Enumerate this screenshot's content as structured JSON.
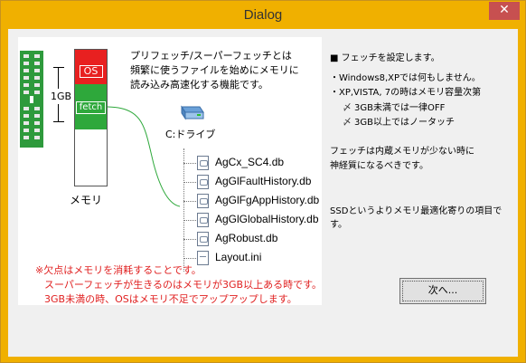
{
  "window": {
    "title": "Dialog",
    "close_glyph": "✕"
  },
  "diagram": {
    "memory_label": "メモリ",
    "os_label": "OS",
    "fetch_label": "fetch",
    "gb_label": "1GB",
    "intro_lines": [
      "プリフェッチ/スーパーフェッチとは",
      "頻繁に使うファイルを始めにメモリに",
      "読み込み高速化する機能です。"
    ],
    "drive_label": "C:ドライブ",
    "files": [
      "AgCx_SC4.db",
      "AgGlFaultHistory.db",
      "AgGlFgAppHistory.db",
      "AgGlGlobalHistory.db",
      "AgRobust.db",
      "Layout.ini"
    ],
    "notes": [
      "※欠点はメモリを消耗することです。",
      "スーパーフェッチが生きるのはメモリが3GB以上ある時です。",
      "3GB未満の時、OSはメモリ不足でアップアップします。"
    ],
    "colors": {
      "os": "#e82020",
      "fetch": "#2ea83b",
      "note": "#e02020"
    }
  },
  "settings": {
    "heading": "■ フェッチを設定します。",
    "lines": [
      "・Windows8,XPでは何もしません。",
      "・XP,VISTA, 7の時はメモリ容量次第"
    ],
    "options": [
      {
        "icon": "check-icon",
        "label": "3GB未満では一律OFF"
      },
      {
        "icon": "check-icon",
        "label": "3GB以上ではノータッチ"
      }
    ],
    "caution": [
      "フェッチは内蔵メモリが少ない時に",
      "神経質になるべきです。"
    ],
    "ssd_note": "SSDというよりメモリ最適化寄りの項目です。"
  },
  "buttons": {
    "next_label": "次へ..."
  }
}
